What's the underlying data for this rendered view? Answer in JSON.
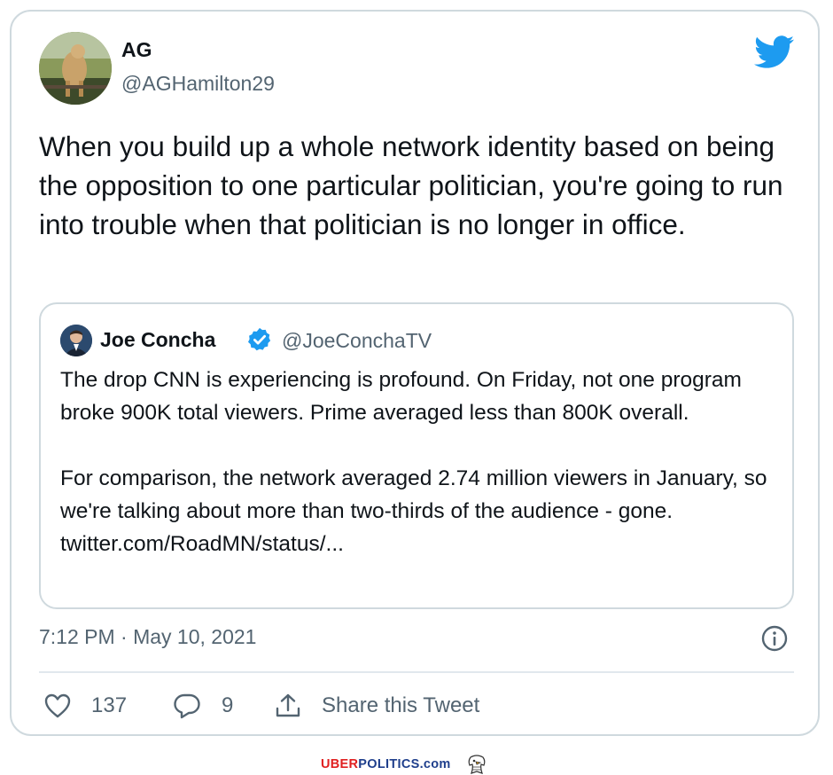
{
  "tweet": {
    "author_name": "AG",
    "author_handle": "@AGHamilton29",
    "text": "When you build up a whole network identity based on being the opposition to one particular politician, you're going to run into trouble when that politician is no longer in office.",
    "timestamp": "7:12 PM · May 10, 2021",
    "likes": "137",
    "replies": "9",
    "share_label": "Share this Tweet"
  },
  "quote": {
    "author_name": "Joe Concha",
    "author_handle": "@JoeConchaTV",
    "verified": true,
    "text": "The drop CNN is experiencing is profound. On Friday, not one program broke 900K total viewers. Prime averaged less than 800K overall.\n\nFor comparison, the network averaged 2.74 million viewers in January, so we're talking about more than two-thirds of the audience - gone. twitter.com/RoadMN/status/..."
  },
  "footer": {
    "brand_part1": "UBER",
    "brand_part2": "POLITICS",
    "brand_part3": ".com"
  },
  "icons": {
    "twitter_bird": "twitter-bird-icon",
    "verified": "verified-badge-icon",
    "info": "info-icon",
    "like": "heart-icon",
    "reply": "reply-bubble-icon",
    "share": "share-upload-icon",
    "eagle": "eagle-logo-icon"
  },
  "colors": {
    "twitter_blue": "#1d9bf0",
    "secondary_text": "#536471",
    "border": "#cfd9de",
    "brand_red": "#e02020",
    "brand_blue": "#1f3f8c"
  }
}
